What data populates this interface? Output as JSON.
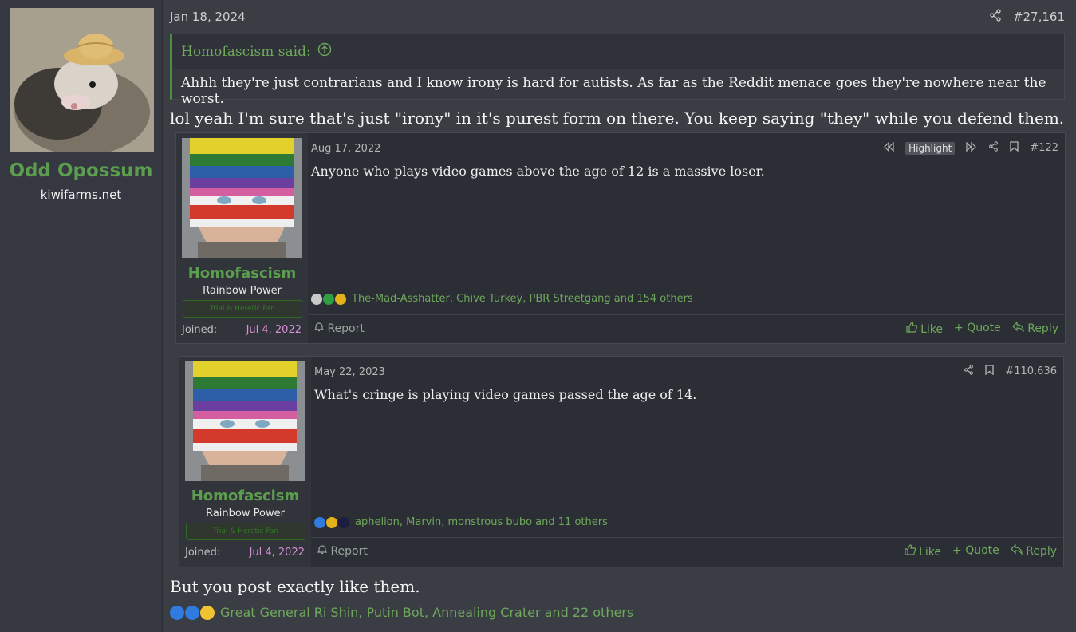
{
  "post": {
    "author": "Odd Opossum",
    "author_site": "kiwifarms.net",
    "date": "Jan 18, 2024",
    "post_number": "#27,161",
    "quote": {
      "author_said": "Homofascism said:",
      "text": "Ahhh they're just contrarians and I know irony is hard for autists. As far as the Reddit menace goes they're nowhere near the worst."
    },
    "message_top": "lol yeah I'm sure that's just \"irony\" in it's purest form on there. You keep saying \"they\" while you defend them.",
    "message_bottom": "But you post exactly like them.",
    "reactions_text": "Great General Ri Shin, Putin Bot, Annealing Crater and 22 others"
  },
  "embeds": [
    {
      "name": "Homofascism",
      "user_title": "Rainbow Power",
      "banner": "Trial & Heretic Fan",
      "joined_label": "Joined:",
      "joined_date": "Jul 4, 2022",
      "date": "Aug 17, 2022",
      "highlight": "Highlight",
      "post_number": "#122",
      "text": "Anyone who plays video games above the age of 12 is a massive loser.",
      "reactions_text": "The-Mad-Asshatter, Chive Turkey, PBR Streetgang and 154 others",
      "report": "Report",
      "like": "Like",
      "quote": "+ Quote",
      "reply": "Reply"
    },
    {
      "name": "Homofascism",
      "user_title": "Rainbow Power",
      "banner": "Trial & Heretic Fan",
      "joined_label": "Joined:",
      "joined_date": "Jul 4, 2022",
      "date": "May 22, 2023",
      "post_number": "#110,636",
      "text": "What's cringe is playing video games passed the age of 14.",
      "reactions_text": "aphelion, Marvin, monstrous bubo and 11 others",
      "report": "Report",
      "like": "Like",
      "quote": "+ Quote",
      "reply": "Reply"
    }
  ],
  "colors": {
    "username": "#5b9e4d",
    "accent_green": "#6fa85c",
    "joined_date": "#d78fd5",
    "background": "#3a3d44"
  },
  "icons": [
    "share-icon",
    "arrow-up-circle-icon",
    "rewind-icon",
    "fast-forward-icon",
    "bookmark-icon",
    "bell-icon",
    "thumbs-up-icon",
    "reply-icon"
  ]
}
